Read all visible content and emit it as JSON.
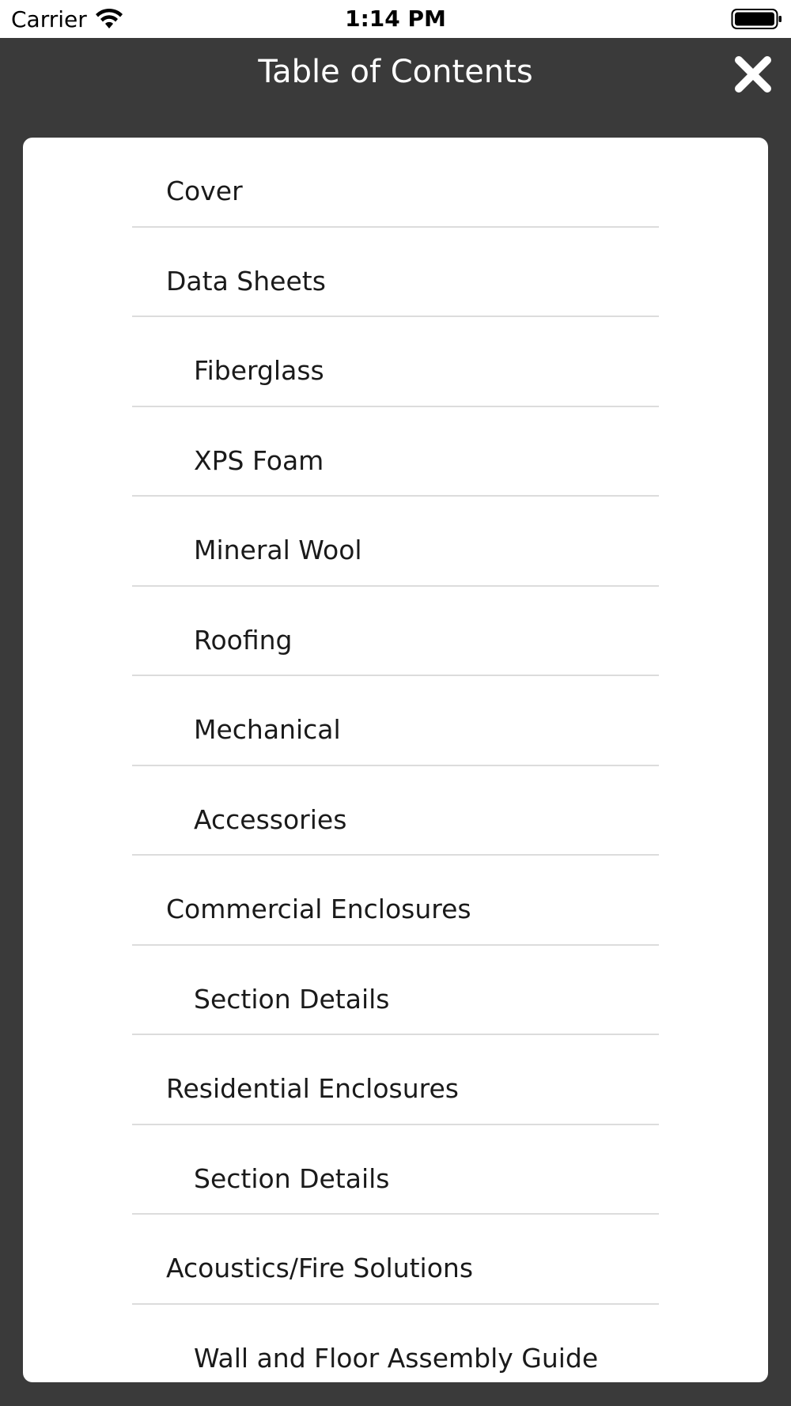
{
  "status_bar": {
    "carrier": "Carrier",
    "time": "1:14 PM",
    "wifi_icon": "wifi-icon",
    "battery_icon": "battery-icon"
  },
  "header": {
    "title": "Table of Contents",
    "close_icon": "close-icon",
    "background": "#3a3a3a"
  },
  "toc": {
    "items": [
      {
        "label": "Cover",
        "level": 0
      },
      {
        "label": "Data Sheets",
        "level": 0
      },
      {
        "label": "Fiberglass",
        "level": 1
      },
      {
        "label": "XPS Foam",
        "level": 1
      },
      {
        "label": "Mineral Wool",
        "level": 1
      },
      {
        "label": "Roofing",
        "level": 1
      },
      {
        "label": "Mechanical",
        "level": 1
      },
      {
        "label": "Accessories",
        "level": 1
      },
      {
        "label": "Commercial Enclosures",
        "level": 0
      },
      {
        "label": "Section Details",
        "level": 1
      },
      {
        "label": "Residential Enclosures",
        "level": 0
      },
      {
        "label": "Section Details",
        "level": 1
      },
      {
        "label": "Acoustics/Fire Solutions",
        "level": 0
      },
      {
        "label": "Wall and Floor Assembly Guide",
        "level": 1
      }
    ]
  }
}
